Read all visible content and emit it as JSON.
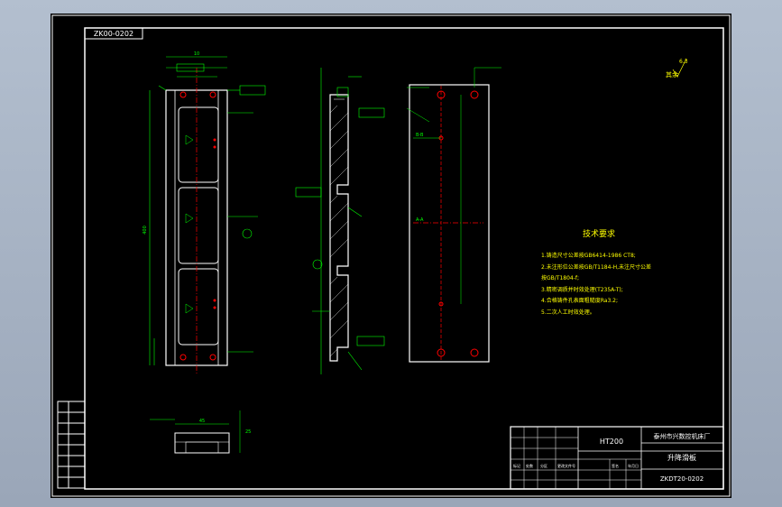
{
  "drawing": {
    "corner_code": "ZK00-0202",
    "roughness_symbol": "其余",
    "roughness_value": "6.3",
    "tech_title": "技术要求",
    "tech_items": [
      "1.铸造尺寸公差按GB6414-1986 CT8;",
      "2.未注形位公差按GB/T1184-H,未注尺寸公差",
      "   按GB/T1804-f;",
      "3.精密调质并时效处理(T235A-T);",
      "4.合格铸件孔表面粗糙度Ra3.2;",
      "5.二次人工时效处理。"
    ],
    "title_block": {
      "material": "HT200",
      "company": "泰州市兴数控机床厂",
      "part_name": "升降滑板",
      "drawing_no": "ZKDT20-0202"
    },
    "side_table": [
      "标记",
      "处数",
      "分区",
      "更改文件号",
      "签名",
      "年月日"
    ],
    "dims": {
      "top_width": "10",
      "overall_height": "400",
      "small_view_width": "45",
      "small_view_height": "25",
      "centerline_a": "A",
      "note_a": "A-A",
      "note_b": "B-B"
    }
  },
  "colors": {
    "outline": "#ffffff",
    "geometry": "#ffffff",
    "dimension": "#00ff00",
    "centerline": "#ff0000",
    "text": "#ffff00",
    "frame": "#ffffff"
  }
}
